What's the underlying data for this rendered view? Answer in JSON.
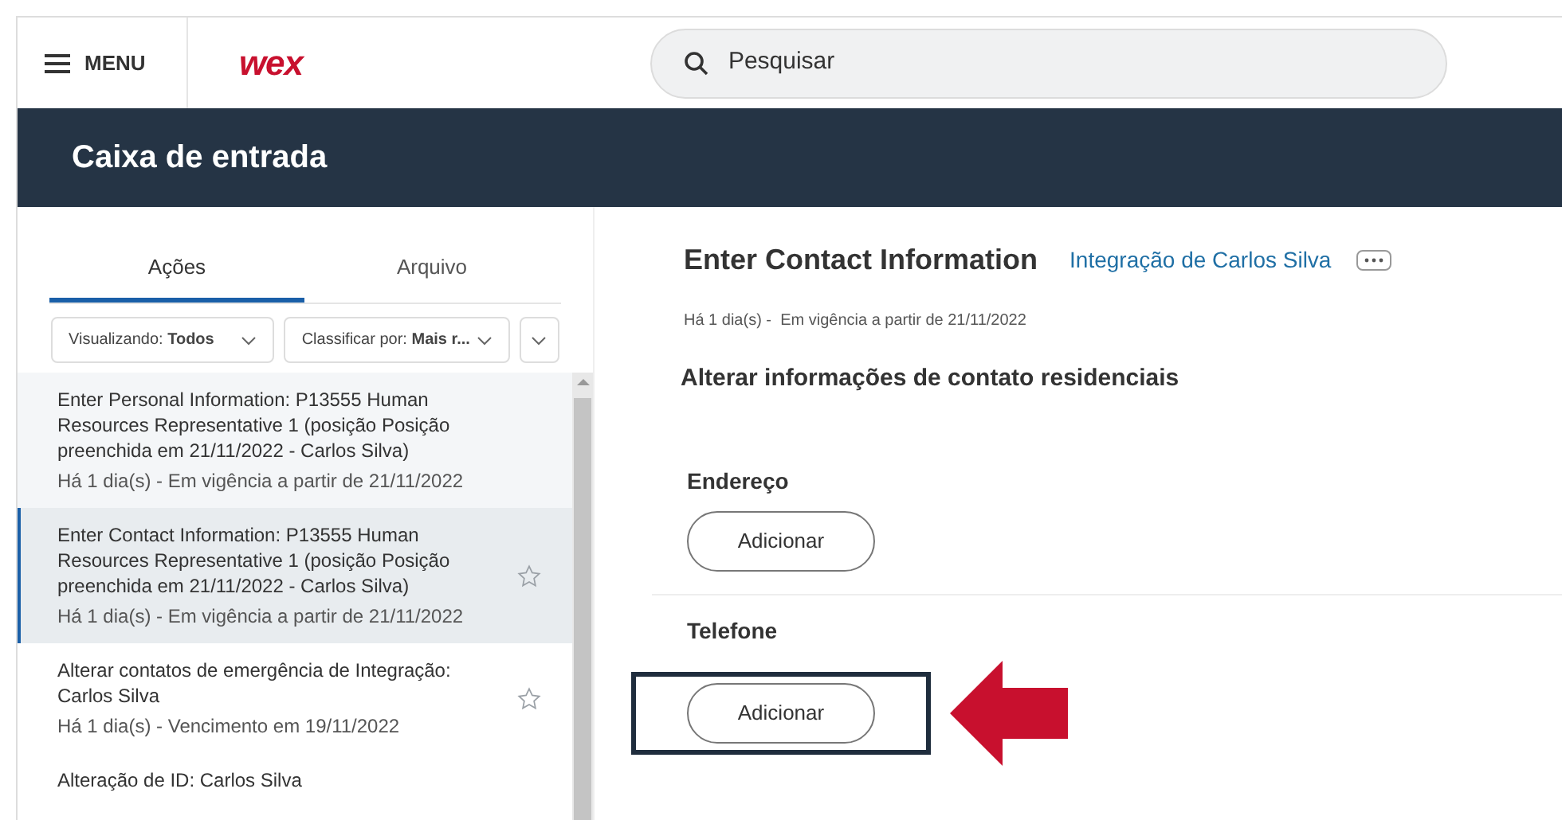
{
  "header": {
    "menu_label": "MENU",
    "logo": "wex",
    "search": {
      "placeholder": "Pesquisar"
    }
  },
  "page_title": "Caixa de entrada",
  "tabs": [
    {
      "label": "Ações",
      "selected": true
    },
    {
      "label": "Arquivo",
      "selected": false
    }
  ],
  "filters": [
    {
      "label": "Visualizando:",
      "value": "Todos"
    },
    {
      "label": "Classificar por:",
      "value": "Mais r..."
    }
  ],
  "inbox_items": [
    {
      "title": "Enter Personal Information: P13555 Human Resources Representative 1 (posição Posição preenchida em 21/11/2022 - Carlos Silva)",
      "meta": "Há 1 dia(s) - Em vigência a partir de 21/11/2022",
      "selected": false,
      "star": false
    },
    {
      "title": "Enter Contact Information: P13555 Human Resources Representative 1 (posição Posição preenchida em 21/11/2022 - Carlos Silva)",
      "meta": "Há 1 dia(s) - Em vigência a partir de 21/11/2022",
      "selected": true,
      "star": true
    },
    {
      "title": "Alterar contatos de emergência de Integração: Carlos Silva",
      "meta": "Há 1 dia(s) - Vencimento em 19/11/2022",
      "selected": false,
      "star": true
    },
    {
      "title": "Alteração de ID: Carlos Silva",
      "selected": false,
      "star": false
    }
  ],
  "detail": {
    "title": "Enter Contact Information",
    "link": "Integração de Carlos Silva",
    "meta": "Há 1 dia(s) -  Em vigência a partir de 21/11/2022",
    "section_title": "Alterar informações de contato residenciais",
    "sections": [
      {
        "label": "Endereço",
        "button": "Adicionar",
        "highlighted": false
      },
      {
        "label": "Telefone",
        "button": "Adicionar",
        "highlighted": true
      }
    ]
  }
}
